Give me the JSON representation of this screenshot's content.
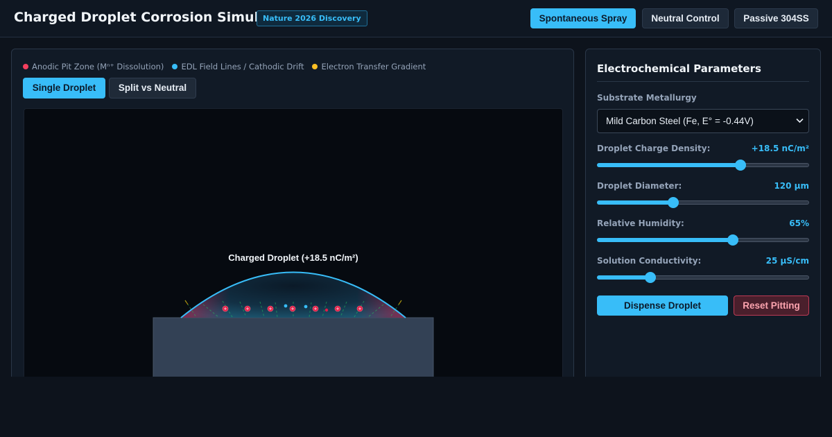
{
  "header": {
    "title": "Charged Droplet Corrosion Simulator",
    "badge": "Nature 2026 Discovery",
    "modes": [
      {
        "label": "Spontaneous Spray",
        "active": true
      },
      {
        "label": "Neutral Control",
        "active": false
      },
      {
        "label": "Passive 304SS",
        "active": false
      }
    ]
  },
  "simulation": {
    "legend": [
      {
        "label": "Anodic Pit Zone (Mⁿ⁺ Dissolution)",
        "color": "#f43f5e"
      },
      {
        "label": "EDL Field Lines / Cathodic Drift",
        "color": "#38bdf8"
      },
      {
        "label": "Electron Transfer Gradient",
        "color": "#fbbf24"
      }
    ],
    "views": [
      {
        "label": "Single Droplet",
        "active": true
      },
      {
        "label": "Split vs Neutral",
        "active": false
      }
    ],
    "droplet_label": "Charged Droplet (+18.5 nC/m²)"
  },
  "controls": {
    "title": "Electrochemical Parameters",
    "substrate": {
      "label": "Substrate Metallurgy",
      "value": "Mild Carbon Steel (Fe, E° = -0.44V)"
    },
    "sliders": [
      {
        "label": "Droplet Charge Density:",
        "value_text": "+18.5 nC/m²",
        "fraction": 0.675
      },
      {
        "label": "Droplet Diameter:",
        "value_text": "120 μm",
        "fraction": 0.36
      },
      {
        "label": "Relative Humidity:",
        "value_text": "65%",
        "fraction": 0.64
      },
      {
        "label": "Solution Conductivity:",
        "value_text": "25 μS/cm",
        "fraction": 0.25
      }
    ],
    "dispense_label": "Dispense Droplet",
    "reset_label": "Reset Pitting"
  },
  "colors": {
    "accent": "#38bdf8",
    "anodic": "#f43f5e",
    "electron": "#fbbf24",
    "substrate": "#334155"
  }
}
